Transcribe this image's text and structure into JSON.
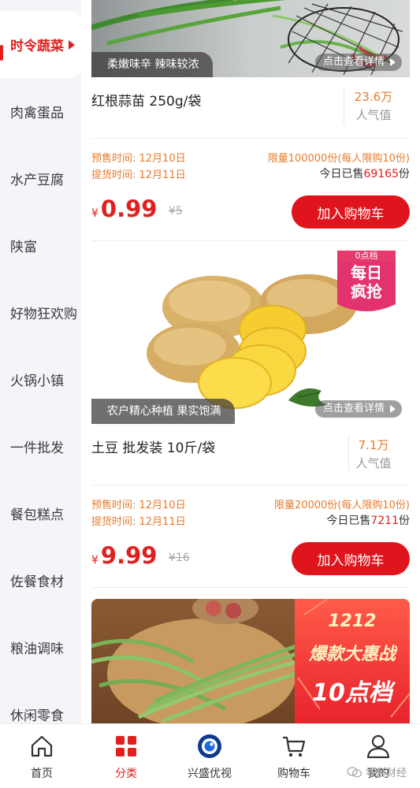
{
  "sidebar": {
    "items": [
      {
        "label": "时令蔬菜",
        "active": true
      },
      {
        "label": "肉禽蛋品"
      },
      {
        "label": "水产豆腐"
      },
      {
        "label": "陕富"
      },
      {
        "label": "好物狂欢购"
      },
      {
        "label": "火锅小镇"
      },
      {
        "label": "一件批发"
      },
      {
        "label": "餐包糕点"
      },
      {
        "label": "佐餐食材"
      },
      {
        "label": "粮油调味"
      },
      {
        "label": "休闲零食"
      }
    ]
  },
  "products": [
    {
      "photo_tag": "柔嫩味辛 辣味较浓",
      "detail_link": "点击查看详情",
      "name": "红根蒜苗 250g/袋",
      "popularity_value": "23.6万",
      "popularity_label": "人气值",
      "presale_time": "预售时间: 12月10日",
      "pickup_time": "提货时间: 12月11日",
      "limit": "限量100000份(每人限购10份)",
      "sold_prefix": "今日已售",
      "sold_count": "69165",
      "sold_suffix": "份",
      "currency": "¥",
      "price": "0.99",
      "original_price": "¥5",
      "cart_button": "加入购物车"
    },
    {
      "badge_top": "0点档",
      "badge_main_1": "每日",
      "badge_main_2": "疯抢",
      "photo_tag": "农户精心种植 果实饱满",
      "detail_link": "点击查看详情",
      "name": "土豆 批发装 10斤/袋",
      "popularity_value": "7.1万",
      "popularity_label": "人气值",
      "presale_time": "预售时间: 12月10日",
      "pickup_time": "提货时间: 12月11日",
      "limit": "限量20000份(每人限购10份)",
      "sold_prefix": "今日已售",
      "sold_count": "7211",
      "sold_suffix": "份",
      "currency": "¥",
      "price": "9.99",
      "original_price": "¥16",
      "cart_button": "加入购物车"
    },
    {
      "banner_line1": "1212",
      "banner_line2": "爆款大惠战",
      "banner_line3": "10点档"
    }
  ],
  "bottom_nav": [
    {
      "label": "首页",
      "icon": "home-icon"
    },
    {
      "label": "分类",
      "icon": "category-icon",
      "active": true
    },
    {
      "label": "兴盛优视",
      "icon": "eye-icon"
    },
    {
      "label": "购物车",
      "icon": "cart-icon"
    },
    {
      "label": "我的",
      "icon": "user-icon"
    }
  ],
  "watermark": "零售财经",
  "colors": {
    "accent": "#e0201f",
    "orange": "#ea7a2a",
    "sidebar_bg": "#f4f5f9"
  }
}
